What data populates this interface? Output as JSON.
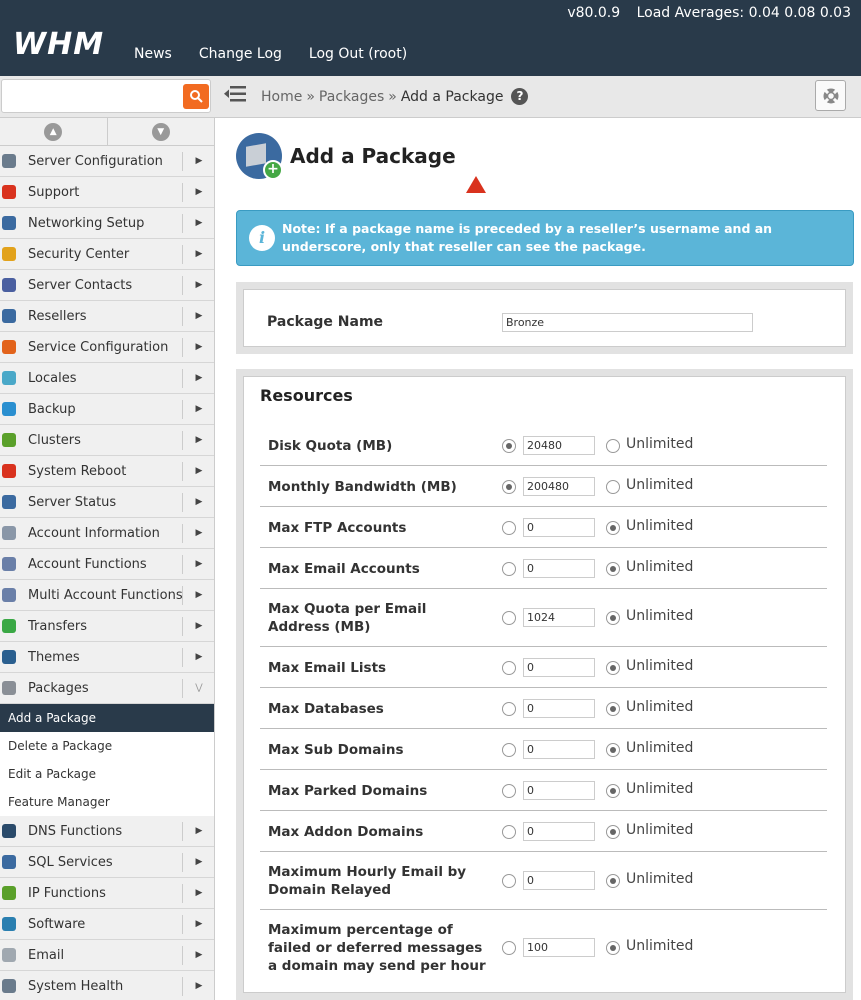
{
  "header": {
    "logo": "WHM",
    "version": "v80.0.9",
    "load_averages": "Load Averages: 0.04 0.08 0.03",
    "nav": [
      "News",
      "Change Log",
      "Log Out (root)"
    ]
  },
  "subbar": {
    "search_placeholder": "",
    "breadcrumb": {
      "home": "Home",
      "sep": "»",
      "packages": "Packages",
      "current": "Add a Package"
    },
    "help": "?"
  },
  "sidebar": {
    "items": [
      {
        "label": "Server Configuration",
        "icon": "server-config-icon",
        "color": "#6a7b8c"
      },
      {
        "label": "Support",
        "icon": "support-icon",
        "color": "#d9321e"
      },
      {
        "label": "Networking Setup",
        "icon": "networking-icon",
        "color": "#3b6aa0"
      },
      {
        "label": "Security Center",
        "icon": "lock-icon",
        "color": "#e2a21b"
      },
      {
        "label": "Server Contacts",
        "icon": "contacts-icon",
        "color": "#4a5fa0"
      },
      {
        "label": "Resellers",
        "icon": "resellers-icon",
        "color": "#3b6aa0"
      },
      {
        "label": "Service Configuration",
        "icon": "service-config-icon",
        "color": "#e2631b"
      },
      {
        "label": "Locales",
        "icon": "locales-icon",
        "color": "#4aa8c8"
      },
      {
        "label": "Backup",
        "icon": "backup-icon",
        "color": "#2a8fd0"
      },
      {
        "label": "Clusters",
        "icon": "clusters-icon",
        "color": "#5aa02a"
      },
      {
        "label": "System Reboot",
        "icon": "reboot-icon",
        "color": "#d9321e"
      },
      {
        "label": "Server Status",
        "icon": "status-icon",
        "color": "#3b6aa0"
      },
      {
        "label": "Account Information",
        "icon": "account-info-icon",
        "color": "#8a97a8"
      },
      {
        "label": "Account Functions",
        "icon": "account-functions-icon",
        "color": "#6a7fa8"
      },
      {
        "label": "Multi Account Functions",
        "icon": "multi-account-icon",
        "color": "#6a7fa8"
      },
      {
        "label": "Transfers",
        "icon": "transfers-icon",
        "color": "#3aa845"
      },
      {
        "label": "Themes",
        "icon": "themes-icon",
        "color": "#2a5f8f"
      },
      {
        "label": "Packages",
        "icon": "packages-icon",
        "color": "#8a8f96"
      }
    ],
    "sub_items": [
      "Add a Package",
      "Delete a Package",
      "Edit a Package",
      "Feature Manager"
    ],
    "items_after": [
      {
        "label": "DNS Functions",
        "icon": "dns-icon",
        "color": "#2a4a6a"
      },
      {
        "label": "SQL Services",
        "icon": "sql-icon",
        "color": "#3b6aa0"
      },
      {
        "label": "IP Functions",
        "icon": "ip-icon",
        "color": "#5aa02a"
      },
      {
        "label": "Software",
        "icon": "software-icon",
        "color": "#2a7fb0"
      },
      {
        "label": "Email",
        "icon": "email-icon",
        "color": "#a0a8b0"
      },
      {
        "label": "System Health",
        "icon": "health-icon",
        "color": "#6a7b8c"
      }
    ],
    "arrow": "▶",
    "expanded_arrow": "⋁"
  },
  "main": {
    "title": "Add a Package",
    "note": "Note: If a package name is preceded by a reseller’s username and an underscore, only that reseller can see the package.",
    "package_name_label": "Package Name",
    "package_name_value": "Bronze",
    "resources_title": "Resources",
    "unlimited_label": "Unlimited",
    "resources": [
      {
        "label": "Disk Quota (MB)",
        "value": "20480",
        "unlimited": false
      },
      {
        "label": "Monthly Bandwidth (MB)",
        "value": "200480",
        "unlimited": false
      },
      {
        "label": "Max FTP Accounts",
        "value": "0",
        "unlimited": true
      },
      {
        "label": "Max Email Accounts",
        "value": "0",
        "unlimited": true
      },
      {
        "label": "Max Quota per Email Address (MB)",
        "value": "1024",
        "unlimited": true
      },
      {
        "label": "Max Email Lists",
        "value": "0",
        "unlimited": true
      },
      {
        "label": "Max Databases",
        "value": "0",
        "unlimited": true
      },
      {
        "label": "Max Sub Domains",
        "value": "0",
        "unlimited": true
      },
      {
        "label": "Max Parked Domains",
        "value": "0",
        "unlimited": true
      },
      {
        "label": "Max Addon Domains",
        "value": "0",
        "unlimited": true
      },
      {
        "label": "Maximum Hourly Email by Domain Relayed",
        "value": "0",
        "unlimited": true
      },
      {
        "label": "Maximum percentage of failed or deferred messages a domain may send per hour",
        "value": "100",
        "unlimited": true
      }
    ]
  }
}
